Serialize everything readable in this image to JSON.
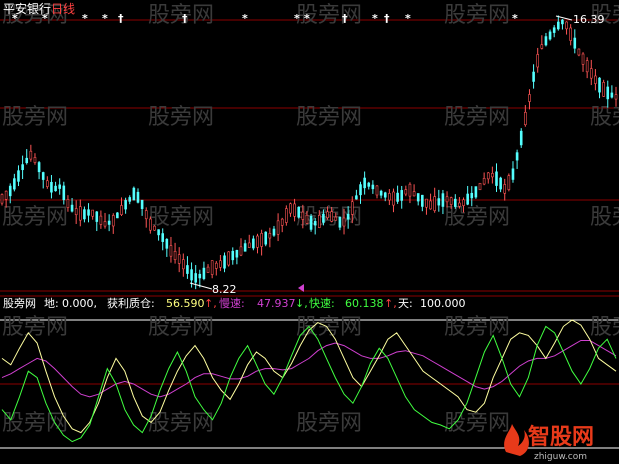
{
  "header": {
    "stock_name": "平安银行",
    "period": "日线"
  },
  "price_labels": {
    "high": "16.39",
    "low": "8.22"
  },
  "indicator": {
    "name": "股旁网",
    "di_label": "地:",
    "di_value": "0.000,",
    "huoli_label": "获利质仓:",
    "huoli_value": "56.590",
    "huoli_arrow": "↑,",
    "man_label": "慢速:",
    "man_value": "47.937",
    "man_arrow": "↓,",
    "kuai_label": "快速:",
    "kuai_value": "60.138",
    "kuai_arrow": "↑,",
    "tian_label": "天:",
    "tian_value": "100.000"
  },
  "watermark": {
    "text": "股旁网",
    "logo_text": "智股网",
    "logo_url": "zhiguw.com"
  },
  "colors": {
    "background": "#000000",
    "grid_red": "#8b0000",
    "candle_up": "#ff5555",
    "candle_down": "#55ffff",
    "line_white": "#ffffff",
    "line_yellow": "#ffffa0",
    "line_green": "#40ff40",
    "line_magenta": "#d040d0"
  },
  "chart_data": {
    "type": "line",
    "price_series": [
      10.8,
      11.0,
      11.4,
      11.9,
      12.2,
      11.8,
      11.3,
      11.1,
      11.2,
      10.6,
      10.4,
      10.3,
      10.4,
      10.2,
      10.0,
      10.1,
      10.4,
      10.7,
      11.0,
      10.6,
      10.0,
      9.8,
      9.5,
      9.1,
      8.9,
      8.6,
      8.3,
      8.4,
      8.6,
      8.7,
      8.8,
      9.0,
      9.1,
      9.3,
      9.4,
      9.5,
      9.6,
      9.8,
      10.1,
      10.5,
      10.4,
      10.2,
      10.0,
      10.1,
      10.3,
      10.2,
      10.0,
      10.3,
      10.9,
      11.3,
      11.2,
      11.0,
      10.9,
      10.8,
      10.9,
      11.1,
      10.9,
      10.7,
      10.6,
      10.7,
      10.8,
      10.7,
      10.6,
      10.8,
      11.0,
      11.3,
      11.6,
      11.4,
      11.1,
      11.5,
      12.5,
      13.6,
      14.8,
      15.6,
      15.9,
      16.2,
      16.4,
      15.9,
      15.4,
      15.0,
      14.6,
      14.3,
      14.1,
      14.0
    ],
    "oscillator": {
      "fast": [
        70,
        65,
        78,
        90,
        82,
        60,
        40,
        25,
        15,
        12,
        20,
        35,
        55,
        70,
        60,
        40,
        25,
        20,
        28,
        45,
        60,
        72,
        80,
        70,
        55,
        45,
        38,
        50,
        65,
        75,
        70,
        60,
        55,
        66,
        80,
        92,
        98,
        95,
        85,
        70,
        55,
        48,
        60,
        72,
        85,
        90,
        80,
        70,
        60,
        55,
        50,
        45,
        40,
        30,
        28,
        35,
        55,
        70,
        85,
        90,
        88,
        80,
        70,
        82,
        95,
        100,
        96,
        85,
        70,
        65,
        60
      ],
      "slow": [
        55,
        58,
        62,
        66,
        70,
        68,
        62,
        55,
        48,
        42,
        40,
        42,
        46,
        50,
        52,
        50,
        46,
        42,
        40,
        42,
        46,
        50,
        55,
        58,
        58,
        56,
        54,
        54,
        56,
        60,
        62,
        62,
        61,
        62,
        66,
        70,
        76,
        80,
        82,
        80,
        76,
        72,
        70,
        70,
        72,
        75,
        76,
        74,
        72,
        68,
        64,
        60,
        56,
        52,
        48,
        46,
        48,
        52,
        58,
        64,
        68,
        70,
        70,
        72,
        76,
        80,
        84,
        84,
        80,
        76,
        72
      ],
      "green": [
        30,
        22,
        40,
        60,
        55,
        35,
        20,
        10,
        5,
        8,
        18,
        40,
        62,
        50,
        30,
        18,
        12,
        25,
        45,
        62,
        75,
        60,
        40,
        30,
        22,
        35,
        55,
        70,
        80,
        65,
        50,
        42,
        55,
        72,
        88,
        95,
        85,
        70,
        55,
        42,
        35,
        48,
        66,
        78,
        70,
        55,
        40,
        30,
        25,
        20,
        18,
        15,
        22,
        35,
        55,
        75,
        88,
        70,
        50,
        40,
        55,
        80,
        95,
        90,
        75,
        60,
        50,
        62,
        78,
        85,
        70
      ]
    },
    "oscillator_levels": [
      0,
      50,
      100
    ],
    "markers": [
      "*",
      "*",
      "*",
      "*",
      "†",
      "†",
      "*",
      "*",
      "*",
      "†",
      "*",
      "†",
      "*",
      "*"
    ]
  }
}
